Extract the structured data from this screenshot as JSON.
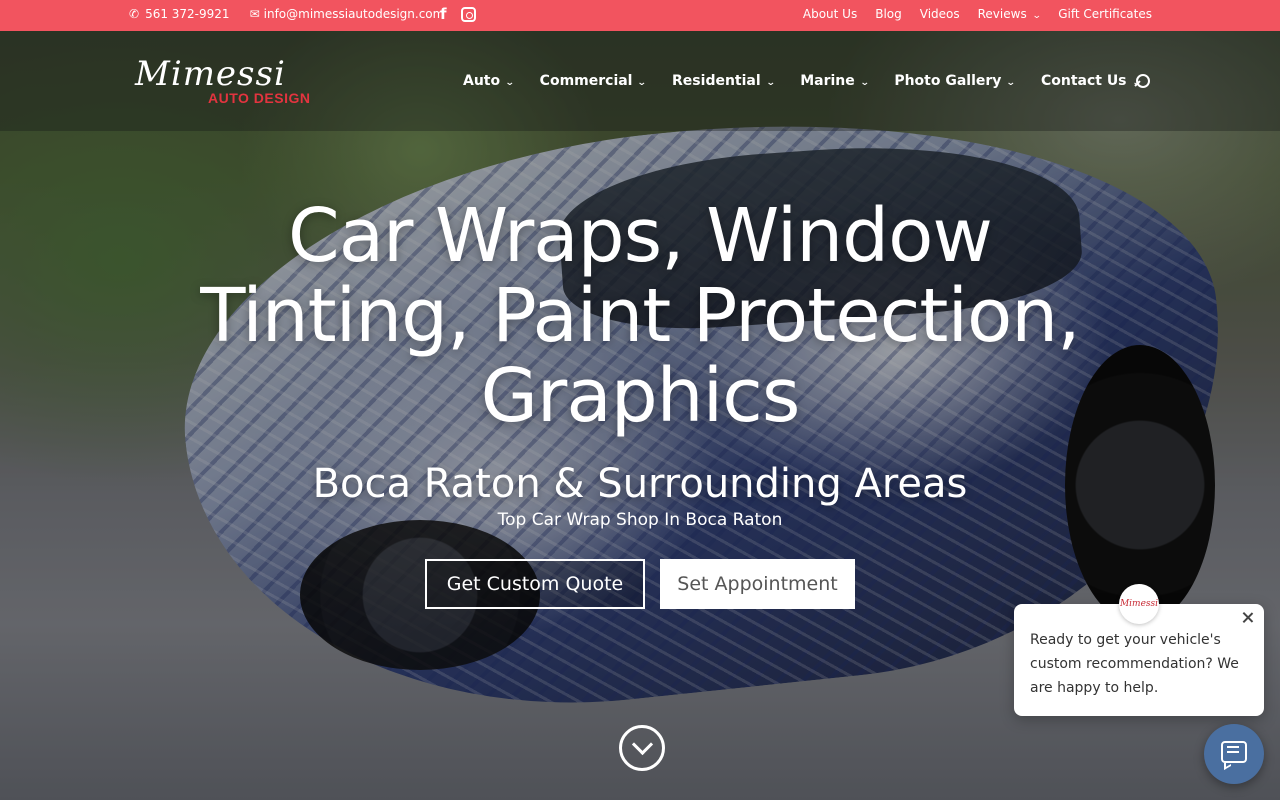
{
  "topbar": {
    "phone": "561 372-9921",
    "email": "info@mimessiautodesign.com",
    "social": [
      "facebook-icon",
      "instagram-icon"
    ],
    "links": [
      {
        "label": "About Us",
        "dropdown": false
      },
      {
        "label": "Blog",
        "dropdown": false
      },
      {
        "label": "Videos",
        "dropdown": false
      },
      {
        "label": "Reviews",
        "dropdown": true
      },
      {
        "label": "Gift Certificates",
        "dropdown": false
      }
    ],
    "color": "#f2545f"
  },
  "logo": {
    "script": "Mimessi",
    "sub": "AUTO DESIGN",
    "accent": "#e3343f"
  },
  "main_nav": [
    {
      "label": "Auto"
    },
    {
      "label": "Commercial"
    },
    {
      "label": "Residential"
    },
    {
      "label": "Marine"
    },
    {
      "label": "Photo Gallery"
    },
    {
      "label": "Contact Us"
    }
  ],
  "hero": {
    "headline_1": "Car Wraps, Window",
    "headline_2": "Tinting, Paint Protection,",
    "headline_3": "Graphics",
    "subheadline": "Boca Raton & Surrounding Areas",
    "tagline": "Top Car Wrap Shop In Boca Raton",
    "cta_primary": "Get Custom Quote",
    "cta_secondary": "Set Appointment"
  },
  "chat": {
    "avatar_text": "Mimessi",
    "message": "Ready to get your vehicle's custom recommendation? We are happy to help.",
    "launcher_color": "#4a6fa0"
  }
}
